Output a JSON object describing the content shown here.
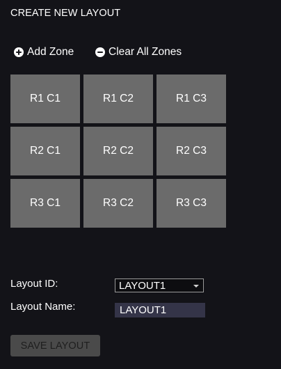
{
  "header": {
    "title": "CREATE NEW LAYOUT"
  },
  "actions": {
    "add_zone": {
      "label": "Add Zone",
      "icon": "plus-circle-icon"
    },
    "clear_zones": {
      "label": "Clear All Zones",
      "icon": "minus-circle-icon"
    }
  },
  "grid": {
    "cells": [
      "R1 C1",
      "R1 C2",
      "R1 C3",
      "R2 C1",
      "R2 C2",
      "R2 C3",
      "R3 C1",
      "R3 C2",
      "R3 C3"
    ]
  },
  "form": {
    "layout_id_label": "Layout ID:",
    "layout_id_value": "LAYOUT1",
    "layout_name_label": "Layout Name:",
    "layout_name_value": "LAYOUT1"
  },
  "footer": {
    "save_label": "SAVE LAYOUT"
  },
  "colors": {
    "background": "#131318",
    "cell": "#6b6b6b",
    "input": "#343448",
    "button_disabled": "#4a4a4a"
  }
}
